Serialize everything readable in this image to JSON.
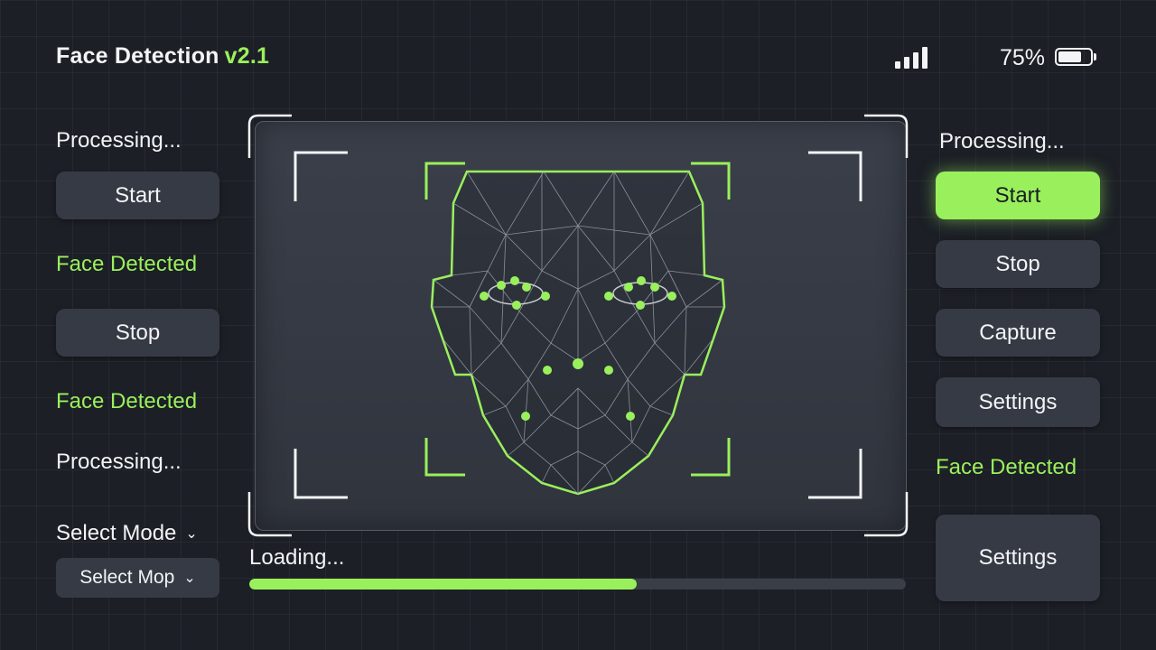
{
  "header": {
    "title": "Face Detection",
    "version": "v2.1",
    "signal_icon": "signal-bars-icon",
    "battery_percent_label": "75%",
    "battery_level": 0.75,
    "battery_icon": "battery-icon"
  },
  "left_panel": {
    "status_1": "Processing...",
    "start_label": "Start",
    "status_2": "Face Detected",
    "stop_label": "Stop",
    "status_3": "Face Detected",
    "status_4": "Processing...",
    "mode_label": "Select Mode",
    "mode_select_value": "Select Mop"
  },
  "right_panel": {
    "status_1": "Processing...",
    "start_label": "Start",
    "stop_label": "Stop",
    "capture_label": "Capture",
    "settings_label": "Settings",
    "status_2": "Face Detected",
    "settings_large_label": "Settings"
  },
  "viewport": {
    "mesh_icon": "face-mesh-icon"
  },
  "progress": {
    "label": "Loading...",
    "value": 0.59
  },
  "colors": {
    "accent": "#9af05c",
    "background": "#1c1f26",
    "button": "#363a44",
    "text": "#f2f4f6"
  }
}
